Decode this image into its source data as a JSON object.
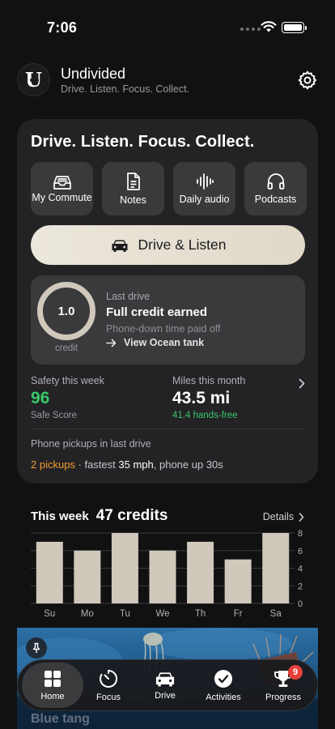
{
  "status_bar": {
    "time": "7:06"
  },
  "header": {
    "app_name": "Undivided",
    "tagline": "Drive. Listen. Focus. Collect."
  },
  "card": {
    "title": "Drive. Listen. Focus. Collect.",
    "tiles": [
      {
        "label": "My Commute",
        "icon": "inbox-tray-icon"
      },
      {
        "label": "Notes",
        "icon": "document-icon"
      },
      {
        "label": "Daily audio",
        "icon": "waveform-icon"
      },
      {
        "label": "Podcasts",
        "icon": "headphones-icon"
      }
    ],
    "drive_button": "Drive & Listen",
    "last_drive": {
      "ring_value": "1.0",
      "ring_label": "credit",
      "kicker": "Last drive",
      "title": "Full credit earned",
      "subtitle": "Phone-down time paid off",
      "link": "View Ocean tank"
    },
    "safety": {
      "label": "Safety this week",
      "value": "96",
      "sub": "Safe Score"
    },
    "miles": {
      "label": "Miles this month",
      "value": "43.5 mi",
      "sub": "41.4 hands-free"
    },
    "pickups": {
      "label": "Phone pickups in last drive",
      "count": "2 pickups",
      "sep": " · fastest ",
      "speed": "35 mph",
      "tail": ", phone up 30s"
    }
  },
  "week": {
    "label": "This week",
    "credits": "47 credits",
    "details": "Details"
  },
  "chart_data": {
    "type": "bar",
    "categories": [
      "Su",
      "Mo",
      "Tu",
      "We",
      "Th",
      "Fr",
      "Sa"
    ],
    "values": [
      7,
      6,
      8,
      6,
      7,
      5,
      8
    ],
    "yticks": [
      0,
      2,
      4,
      6,
      8
    ],
    "ylim": [
      0,
      8
    ],
    "title": "",
    "xlabel": "",
    "ylabel": "",
    "grid": true,
    "bar_color": "#cfc8bb"
  },
  "image_strip": {
    "caption": "Blue tang"
  },
  "tabbar": {
    "tabs": [
      {
        "label": "Home",
        "icon": "grid-icon"
      },
      {
        "label": "Focus",
        "icon": "timer-icon"
      },
      {
        "label": "Drive",
        "icon": "car-icon"
      },
      {
        "label": "Activities",
        "icon": "check-circle-icon"
      },
      {
        "label": "Progress",
        "icon": "trophy-icon",
        "badge": "9"
      }
    ],
    "active": "Home"
  },
  "colors": {
    "accent_green": "#39c86a",
    "accent_orange": "#f39a2e",
    "badge_red": "#e5413b",
    "cream": "#e8e2d6"
  }
}
